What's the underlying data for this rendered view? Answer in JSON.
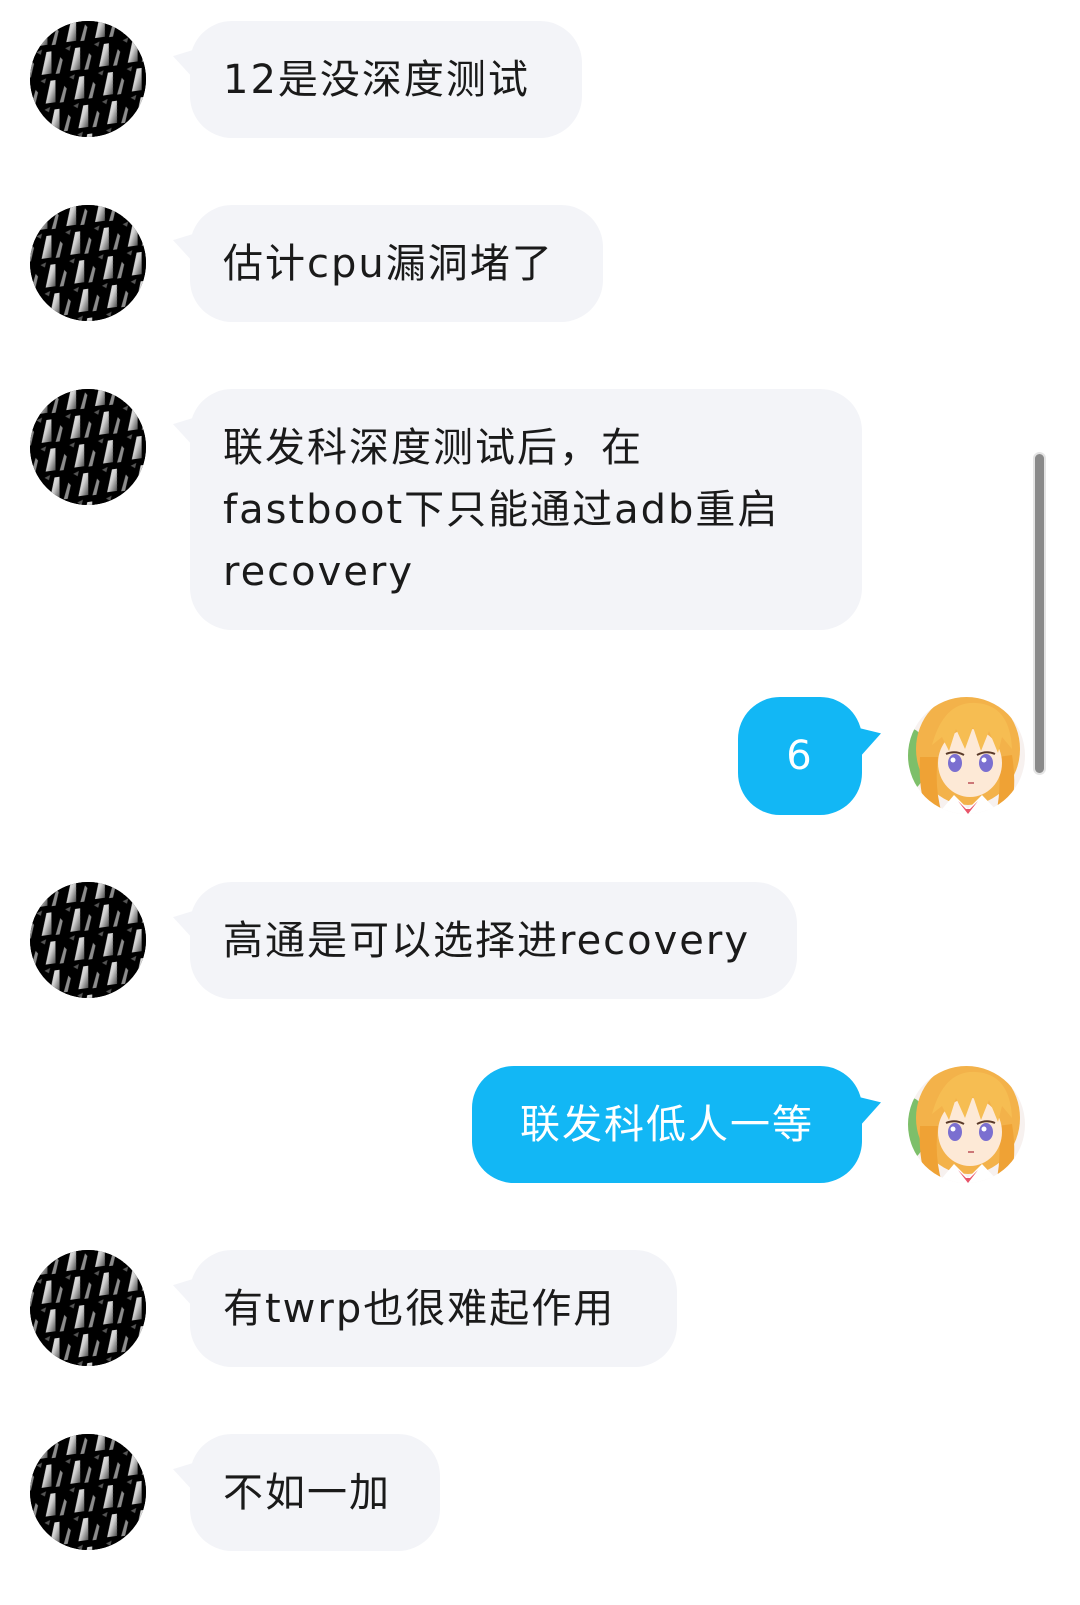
{
  "messages": [
    {
      "from_self": false,
      "lines": [
        "12是没深度测试"
      ]
    },
    {
      "from_self": false,
      "lines": [
        "估计cpu漏洞堵了"
      ]
    },
    {
      "from_self": false,
      "lines": [
        "联发科深度测试后，在",
        "fastboot下只能通过adb重启",
        "recovery"
      ]
    },
    {
      "from_self": true,
      "lines": [
        "6"
      ]
    },
    {
      "from_self": false,
      "lines": [
        "高通是可以选择进recovery"
      ]
    },
    {
      "from_self": true,
      "lines": [
        "联发科低人一等"
      ]
    },
    {
      "from_self": false,
      "lines": [
        "有twrp也很难起作用"
      ]
    },
    {
      "from_self": false,
      "lines": [
        "不如一加"
      ]
    }
  ],
  "avatars": {
    "contact": "black-metallic-pattern-avatar",
    "self": "anime-girl-avatar"
  },
  "colors": {
    "left_bubble": "#f3f4f8",
    "right_bubble": "#12b7f5",
    "left_text": "#1a1a1a",
    "right_text": "#ffffff",
    "page_bg": "#ffffff",
    "scroll_thumb": "#8a8a8a"
  }
}
